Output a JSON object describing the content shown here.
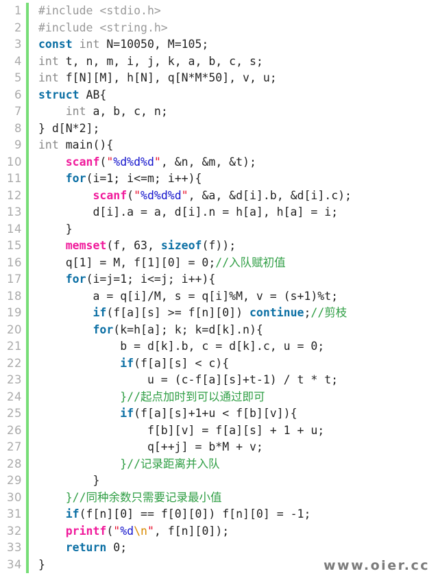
{
  "editor": {
    "language": "C",
    "gutter_bar_color": "#77dd77",
    "background_color": "#ffffff",
    "line_number_color": "#aaaaaa",
    "total_lines": 34
  },
  "watermark": {
    "text": "www.oier.cc",
    "color": "#7b7b7b"
  },
  "palette": {
    "plain": "#222222",
    "type": "#888888",
    "preprocessor": "#999999",
    "keyword": "#0b6fa4",
    "function": "#f01a9b",
    "string": "#e8112d",
    "format_specifier": "#1414cc",
    "escape": "#d98a00",
    "comment": "#2f9e44"
  },
  "lines": [
    {
      "n": "1",
      "tokens": [
        {
          "t": "pre",
          "s": "#include <stdio.h>"
        }
      ]
    },
    {
      "n": "2",
      "tokens": [
        {
          "t": "pre",
          "s": "#include <string.h>"
        }
      ]
    },
    {
      "n": "3",
      "tokens": [
        {
          "t": "keyword",
          "s": "const"
        },
        {
          "t": "plain",
          "s": " "
        },
        {
          "t": "type",
          "s": "int"
        },
        {
          "t": "plain",
          "s": " N=10050, M=105;"
        }
      ]
    },
    {
      "n": "4",
      "tokens": [
        {
          "t": "type",
          "s": "int"
        },
        {
          "t": "plain",
          "s": " t, n, m, i, j, k, a, b, c, s;"
        }
      ]
    },
    {
      "n": "5",
      "tokens": [
        {
          "t": "type",
          "s": "int"
        },
        {
          "t": "plain",
          "s": " f[N][M], h[N], q[N*M*50], v, u;"
        }
      ]
    },
    {
      "n": "6",
      "tokens": [
        {
          "t": "keyword",
          "s": "struct"
        },
        {
          "t": "plain",
          "s": " AB{"
        }
      ]
    },
    {
      "n": "7",
      "tokens": [
        {
          "t": "plain",
          "s": "    "
        },
        {
          "t": "type",
          "s": "int"
        },
        {
          "t": "plain",
          "s": " a, b, c, n;"
        }
      ]
    },
    {
      "n": "8",
      "tokens": [
        {
          "t": "plain",
          "s": "} d[N*2];"
        }
      ]
    },
    {
      "n": "9",
      "tokens": [
        {
          "t": "type",
          "s": "int"
        },
        {
          "t": "plain",
          "s": " main(){"
        }
      ]
    },
    {
      "n": "10",
      "tokens": [
        {
          "t": "plain",
          "s": "    "
        },
        {
          "t": "func",
          "s": "scanf"
        },
        {
          "t": "plain",
          "s": "("
        },
        {
          "t": "string",
          "s": "\""
        },
        {
          "t": "fmt",
          "s": "%d%d%d"
        },
        {
          "t": "string",
          "s": "\""
        },
        {
          "t": "plain",
          "s": ", &n, &m, &t);"
        }
      ]
    },
    {
      "n": "11",
      "tokens": [
        {
          "t": "plain",
          "s": "    "
        },
        {
          "t": "keyword",
          "s": "for"
        },
        {
          "t": "plain",
          "s": "(i=1; i<=m; i++){"
        }
      ]
    },
    {
      "n": "12",
      "tokens": [
        {
          "t": "plain",
          "s": "        "
        },
        {
          "t": "func",
          "s": "scanf"
        },
        {
          "t": "plain",
          "s": "("
        },
        {
          "t": "string",
          "s": "\""
        },
        {
          "t": "fmt",
          "s": "%d%d%d"
        },
        {
          "t": "string",
          "s": "\""
        },
        {
          "t": "plain",
          "s": ", &a, &d[i].b, &d[i].c);"
        }
      ]
    },
    {
      "n": "13",
      "tokens": [
        {
          "t": "plain",
          "s": "        d[i].a = a, d[i].n = h[a], h[a] = i;"
        }
      ]
    },
    {
      "n": "14",
      "tokens": [
        {
          "t": "plain",
          "s": "    }"
        }
      ]
    },
    {
      "n": "15",
      "tokens": [
        {
          "t": "plain",
          "s": "    "
        },
        {
          "t": "func",
          "s": "memset"
        },
        {
          "t": "plain",
          "s": "(f, 63, "
        },
        {
          "t": "keyword",
          "s": "sizeof"
        },
        {
          "t": "plain",
          "s": "(f));"
        }
      ]
    },
    {
      "n": "16",
      "tokens": [
        {
          "t": "plain",
          "s": "    q[1] = M, f[1][0] = 0;"
        },
        {
          "t": "comment",
          "s": "//入队赋初值"
        }
      ]
    },
    {
      "n": "17",
      "tokens": [
        {
          "t": "plain",
          "s": "    "
        },
        {
          "t": "keyword",
          "s": "for"
        },
        {
          "t": "plain",
          "s": "(i=j=1; i<=j; i++){"
        }
      ]
    },
    {
      "n": "18",
      "tokens": [
        {
          "t": "plain",
          "s": "        a = q[i]/M, s = q[i]%M, v = (s+1)%t;"
        }
      ]
    },
    {
      "n": "19",
      "tokens": [
        {
          "t": "plain",
          "s": "        "
        },
        {
          "t": "keyword",
          "s": "if"
        },
        {
          "t": "plain",
          "s": "(f[a][s] >= f[n][0]) "
        },
        {
          "t": "keyword",
          "s": "continue"
        },
        {
          "t": "plain",
          "s": ";"
        },
        {
          "t": "comment",
          "s": "//剪枝"
        }
      ]
    },
    {
      "n": "20",
      "tokens": [
        {
          "t": "plain",
          "s": "        "
        },
        {
          "t": "keyword",
          "s": "for"
        },
        {
          "t": "plain",
          "s": "(k=h[a]; k; k=d[k].n){"
        }
      ]
    },
    {
      "n": "21",
      "tokens": [
        {
          "t": "plain",
          "s": "            b = d[k].b, c = d[k].c, u = 0;"
        }
      ]
    },
    {
      "n": "22",
      "tokens": [
        {
          "t": "plain",
          "s": "            "
        },
        {
          "t": "keyword",
          "s": "if"
        },
        {
          "t": "plain",
          "s": "(f[a][s] < c){"
        }
      ]
    },
    {
      "n": "23",
      "tokens": [
        {
          "t": "plain",
          "s": "                u = (c-f[a][s]+t-1) / t * t;"
        }
      ]
    },
    {
      "n": "24",
      "tokens": [
        {
          "t": "plain",
          "s": "            "
        },
        {
          "t": "comment",
          "s": "}//起点加时到可以通过即可"
        }
      ]
    },
    {
      "n": "25",
      "tokens": [
        {
          "t": "plain",
          "s": "            "
        },
        {
          "t": "keyword",
          "s": "if"
        },
        {
          "t": "plain",
          "s": "(f[a][s]+1+u < f[b][v]){"
        }
      ]
    },
    {
      "n": "26",
      "tokens": [
        {
          "t": "plain",
          "s": "                f[b][v] = f[a][s] + 1 + u;"
        }
      ]
    },
    {
      "n": "27",
      "tokens": [
        {
          "t": "plain",
          "s": "                q[++j] = b*M + v;"
        }
      ]
    },
    {
      "n": "28",
      "tokens": [
        {
          "t": "plain",
          "s": "            "
        },
        {
          "t": "comment",
          "s": "}//记录距离并入队"
        }
      ]
    },
    {
      "n": "29",
      "tokens": [
        {
          "t": "plain",
          "s": "        }"
        }
      ]
    },
    {
      "n": "30",
      "tokens": [
        {
          "t": "plain",
          "s": "    "
        },
        {
          "t": "comment",
          "s": "}//同种余数只需要记录最小值"
        }
      ]
    },
    {
      "n": "31",
      "tokens": [
        {
          "t": "plain",
          "s": "    "
        },
        {
          "t": "keyword",
          "s": "if"
        },
        {
          "t": "plain",
          "s": "(f[n][0] == f[0][0]) f[n][0] = -1;"
        }
      ]
    },
    {
      "n": "32",
      "tokens": [
        {
          "t": "plain",
          "s": "    "
        },
        {
          "t": "func",
          "s": "printf"
        },
        {
          "t": "plain",
          "s": "("
        },
        {
          "t": "string",
          "s": "\""
        },
        {
          "t": "fmt",
          "s": "%d"
        },
        {
          "t": "esc",
          "s": "\\n"
        },
        {
          "t": "string",
          "s": "\""
        },
        {
          "t": "plain",
          "s": ", f[n][0]);"
        }
      ]
    },
    {
      "n": "33",
      "tokens": [
        {
          "t": "plain",
          "s": "    "
        },
        {
          "t": "keyword",
          "s": "return"
        },
        {
          "t": "plain",
          "s": " 0;"
        }
      ]
    },
    {
      "n": "34",
      "tokens": [
        {
          "t": "plain",
          "s": "}"
        }
      ]
    }
  ]
}
